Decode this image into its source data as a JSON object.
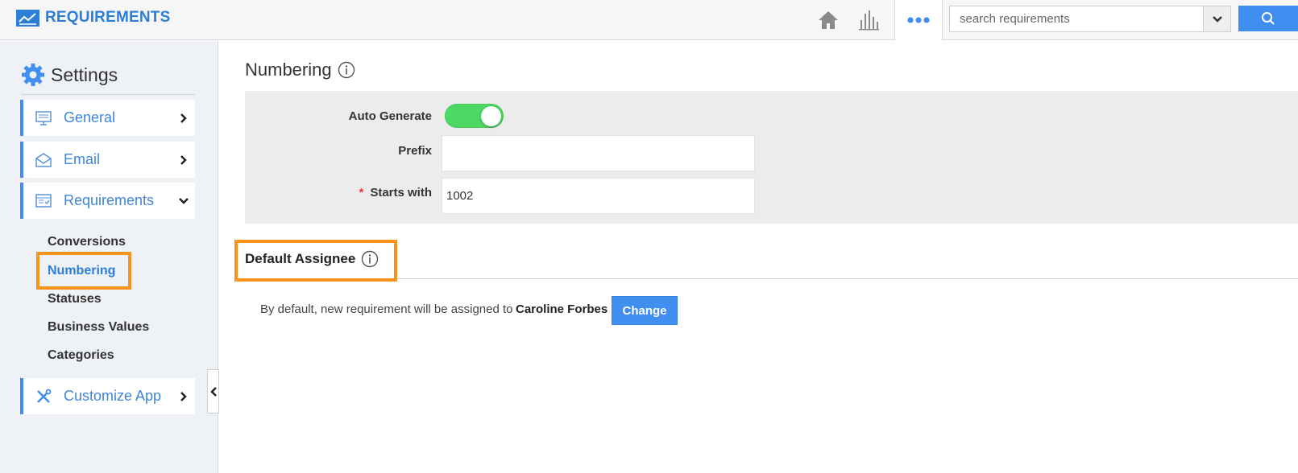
{
  "header": {
    "app_title": "REQUIREMENTS",
    "search": {
      "placeholder": "search requirements"
    },
    "icons": [
      "home-icon",
      "bar-chart-icon",
      "more-dots-icon",
      "chevron-down-icon",
      "search-icon"
    ]
  },
  "sidebar": {
    "title": "Settings",
    "items": [
      {
        "label": "General",
        "icon": "monitor-icon",
        "expanded": false
      },
      {
        "label": "Email",
        "icon": "envelope-icon",
        "expanded": false
      },
      {
        "label": "Requirements",
        "icon": "requirements-icon",
        "expanded": true
      },
      {
        "label": "Customize App",
        "icon": "tools-icon",
        "expanded": false
      }
    ],
    "subitems": [
      "Conversions",
      "Numbering",
      "Statuses",
      "Business Values",
      "Categories"
    ],
    "active_subitem": "Numbering"
  },
  "main": {
    "title": "Numbering",
    "fields": {
      "auto_generate_label": "Auto Generate",
      "auto_generate_on": true,
      "prefix_label": "Prefix",
      "prefix_value": "",
      "starts_with_required": "*",
      "starts_with_label": "Starts with",
      "starts_with_value": "1002"
    },
    "assignee": {
      "title": "Default Assignee",
      "description": "By default, new requirement will be assigned to",
      "name": "Caroline Forbes",
      "change_label": "Change"
    }
  },
  "colors": {
    "accent": "#3f8ef0",
    "brand": "#2d7ed6",
    "highlight": "#f7941d",
    "toggle_on": "#4cd964"
  }
}
